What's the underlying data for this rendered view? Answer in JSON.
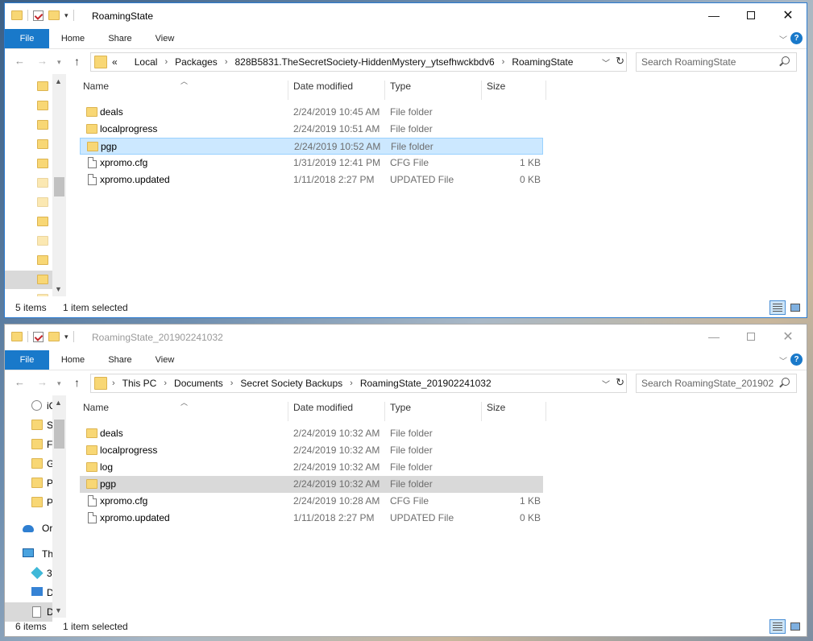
{
  "windows": [
    {
      "title": "RoamingState",
      "active": true,
      "tabs": {
        "file": "File",
        "home": "Home",
        "share": "Share",
        "view": "View"
      },
      "address": {
        "prefix": "«",
        "crumbs": [
          "Local",
          "Packages",
          "828B5831.TheSecretSociety-HiddenMystery_ytsefhwckbdv6",
          "RoamingState"
        ]
      },
      "search_placeholder": "Search RoamingState",
      "columns": {
        "name": "Name",
        "date": "Date modified",
        "type": "Type",
        "size": "Size"
      },
      "rows": [
        {
          "kind": "folder",
          "name": "deals",
          "date": "2/24/2019 10:45 AM",
          "type": "File folder",
          "size": ""
        },
        {
          "kind": "folder",
          "name": "localprogress",
          "date": "2/24/2019 10:51 AM",
          "type": "File folder",
          "size": ""
        },
        {
          "kind": "folder",
          "name": "pgp",
          "date": "2/24/2019 10:52 AM",
          "type": "File folder",
          "size": "",
          "selected": true
        },
        {
          "kind": "file",
          "name": "xpromo.cfg",
          "date": "1/31/2019 12:41 PM",
          "type": "CFG File",
          "size": "1 KB"
        },
        {
          "kind": "file",
          "name": "xpromo.updated",
          "date": "1/11/2018 2:27 PM",
          "type": "UPDATED File",
          "size": "0 KB"
        }
      ],
      "status": {
        "count": "5 items",
        "selected": "1 item selected"
      }
    },
    {
      "title": "RoamingState_201902241032",
      "active": false,
      "tabs": {
        "file": "File",
        "home": "Home",
        "share": "Share",
        "view": "View"
      },
      "address": {
        "prefix": "",
        "crumbs": [
          "This PC",
          "Documents",
          "Secret Society Backups",
          "RoamingState_201902241032"
        ]
      },
      "search_placeholder": "Search RoamingState_201902...",
      "columns": {
        "name": "Name",
        "date": "Date modified",
        "type": "Type",
        "size": "Size"
      },
      "nav_items": [
        {
          "label": "iC",
          "icon": "cloud-drive-icon"
        },
        {
          "label": "S",
          "icon": "folder-icon"
        },
        {
          "label": "F",
          "icon": "folder-icon"
        },
        {
          "label": "G",
          "icon": "folder-icon"
        },
        {
          "label": "P",
          "icon": "folder-icon"
        },
        {
          "label": "P",
          "icon": "folder-icon"
        },
        {
          "label": "Or",
          "icon": "onedrive-icon"
        },
        {
          "label": "Th",
          "icon": "this-pc-icon"
        },
        {
          "label": "3",
          "icon": "3d-objects-icon"
        },
        {
          "label": "D",
          "icon": "desktop-icon"
        },
        {
          "label": "D",
          "icon": "documents-icon"
        }
      ],
      "rows": [
        {
          "kind": "folder",
          "name": "deals",
          "date": "2/24/2019 10:32 AM",
          "type": "File folder",
          "size": ""
        },
        {
          "kind": "folder",
          "name": "localprogress",
          "date": "2/24/2019 10:32 AM",
          "type": "File folder",
          "size": ""
        },
        {
          "kind": "folder",
          "name": "log",
          "date": "2/24/2019 10:32 AM",
          "type": "File folder",
          "size": ""
        },
        {
          "kind": "folder",
          "name": "pgp",
          "date": "2/24/2019 10:32 AM",
          "type": "File folder",
          "size": "",
          "selected": true
        },
        {
          "kind": "file",
          "name": "xpromo.cfg",
          "date": "2/24/2019 10:28 AM",
          "type": "CFG File",
          "size": "1 KB"
        },
        {
          "kind": "file",
          "name": "xpromo.updated",
          "date": "1/11/2018 2:27 PM",
          "type": "UPDATED File",
          "size": "0 KB"
        }
      ],
      "status": {
        "count": "6 items",
        "selected": "1 item selected"
      }
    }
  ],
  "colors": {
    "accent": "#1979ca",
    "folder": "#f8d775",
    "selection_active": "#cce8ff",
    "selection_inactive": "#d9d9d9"
  }
}
